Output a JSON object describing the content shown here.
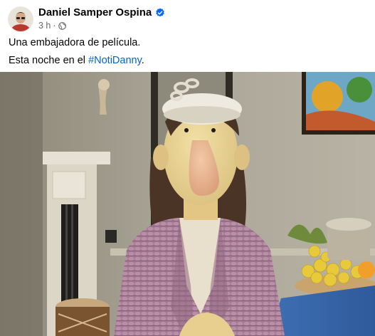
{
  "post": {
    "author": "Daniel Samper Ospina",
    "verified": true,
    "time": "3 h",
    "separator": "·",
    "audience_icon": "globe-icon",
    "caption_line1": "Una embajadora de película.",
    "caption_line2_prefix": "Esta noche en el ",
    "hashtag": "#NotiDanny",
    "caption_line2_suffix": "."
  },
  "colors": {
    "verified_badge": "#0866ff",
    "hashtag": "#0064d1",
    "meta_text": "#65676b"
  }
}
